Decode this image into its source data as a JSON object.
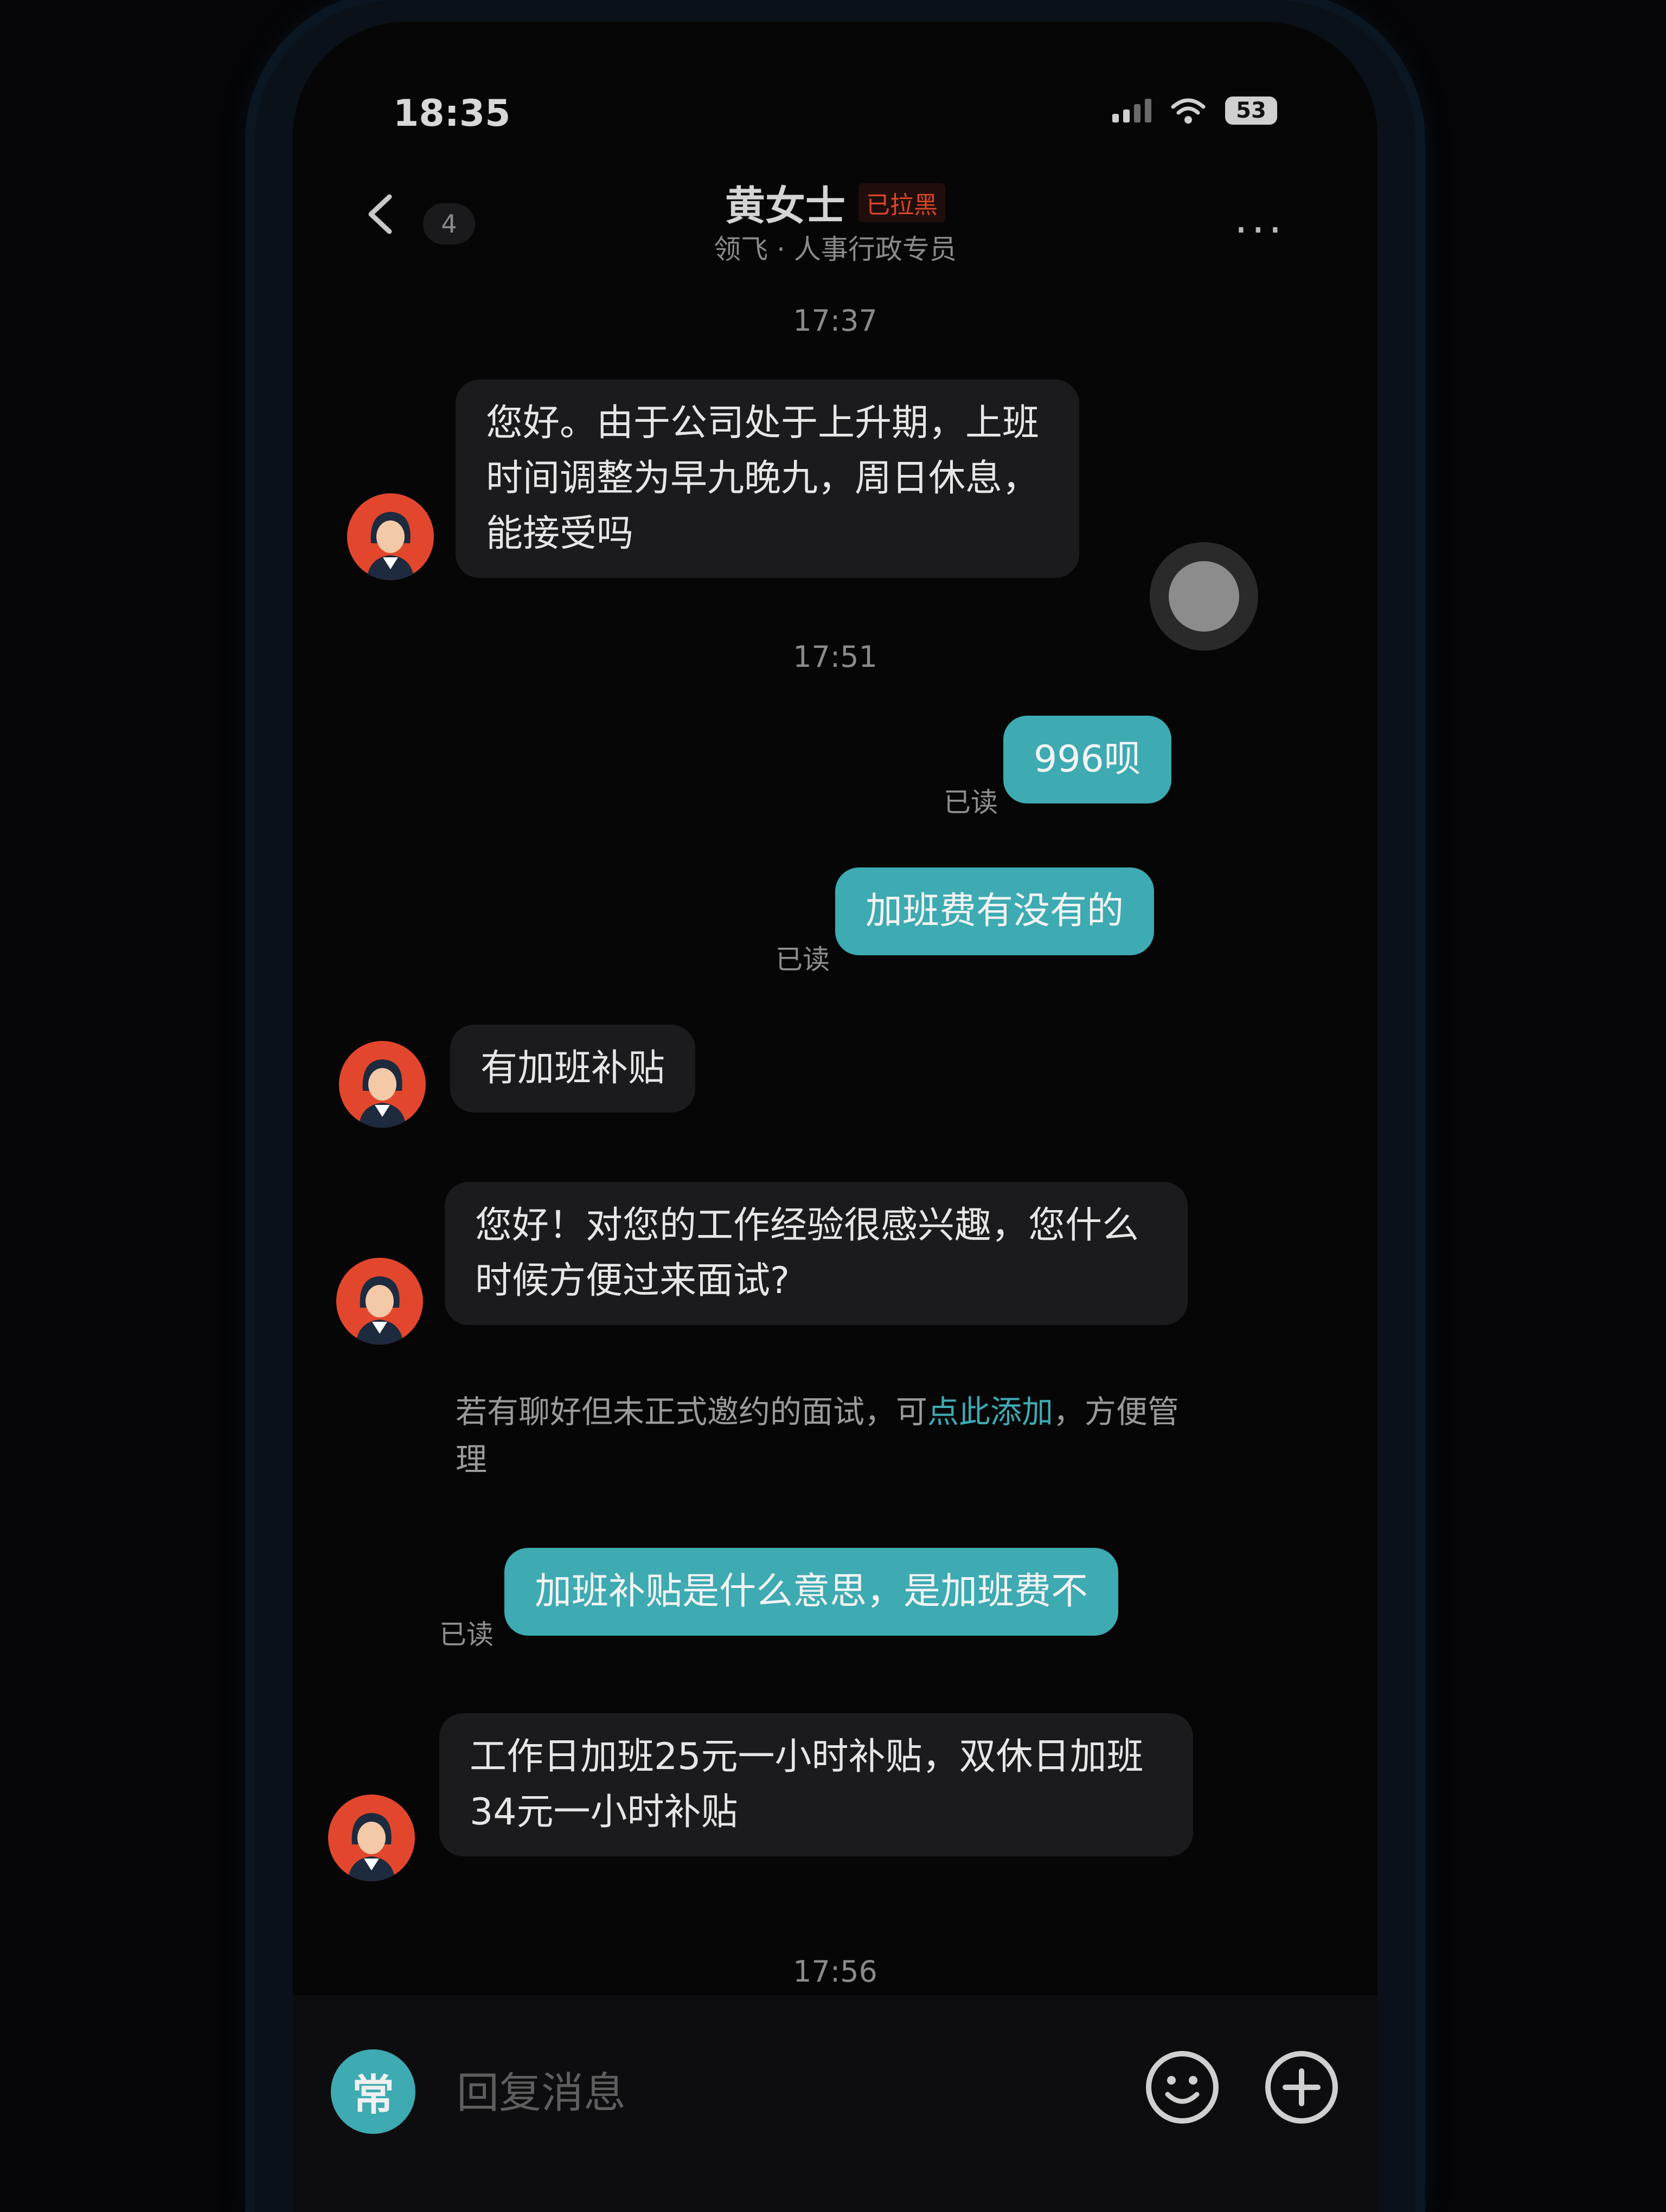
{
  "status_bar": {
    "time": "18:35",
    "battery": "53"
  },
  "header": {
    "unread_count": "4",
    "contact_name": "黄女士",
    "blocked_tag": "已拉黑",
    "subtitle": "领飞 · 人事行政专员"
  },
  "timestamps": [
    "17:37",
    "17:51",
    "17:56"
  ],
  "messages": {
    "m1": "您好。由于公司处于上升期，上班时间调整为早九晚九，周日休息，能接受吗",
    "m2": "996呗",
    "m3": "加班费有没有的",
    "m4": "有加班补贴",
    "m5": "您好！对您的工作经验很感兴趣，您什么时候方便过来面试?",
    "m6": "加班补贴是什么意思，是加班费不",
    "m7": "工作日加班25元一小时补贴，双休日加班34元一小时补贴"
  },
  "read_label": "已读",
  "system_tip": {
    "before": "若有聊好但未正式邀约的面试，可",
    "link": "点此添加",
    "after": "，方便管理"
  },
  "input_bar": {
    "common_label": "常",
    "placeholder": "回复消息"
  },
  "colors": {
    "accent": "#3eaab2",
    "blocked": "#d8462a",
    "avatar_bg": "#e2472d"
  }
}
